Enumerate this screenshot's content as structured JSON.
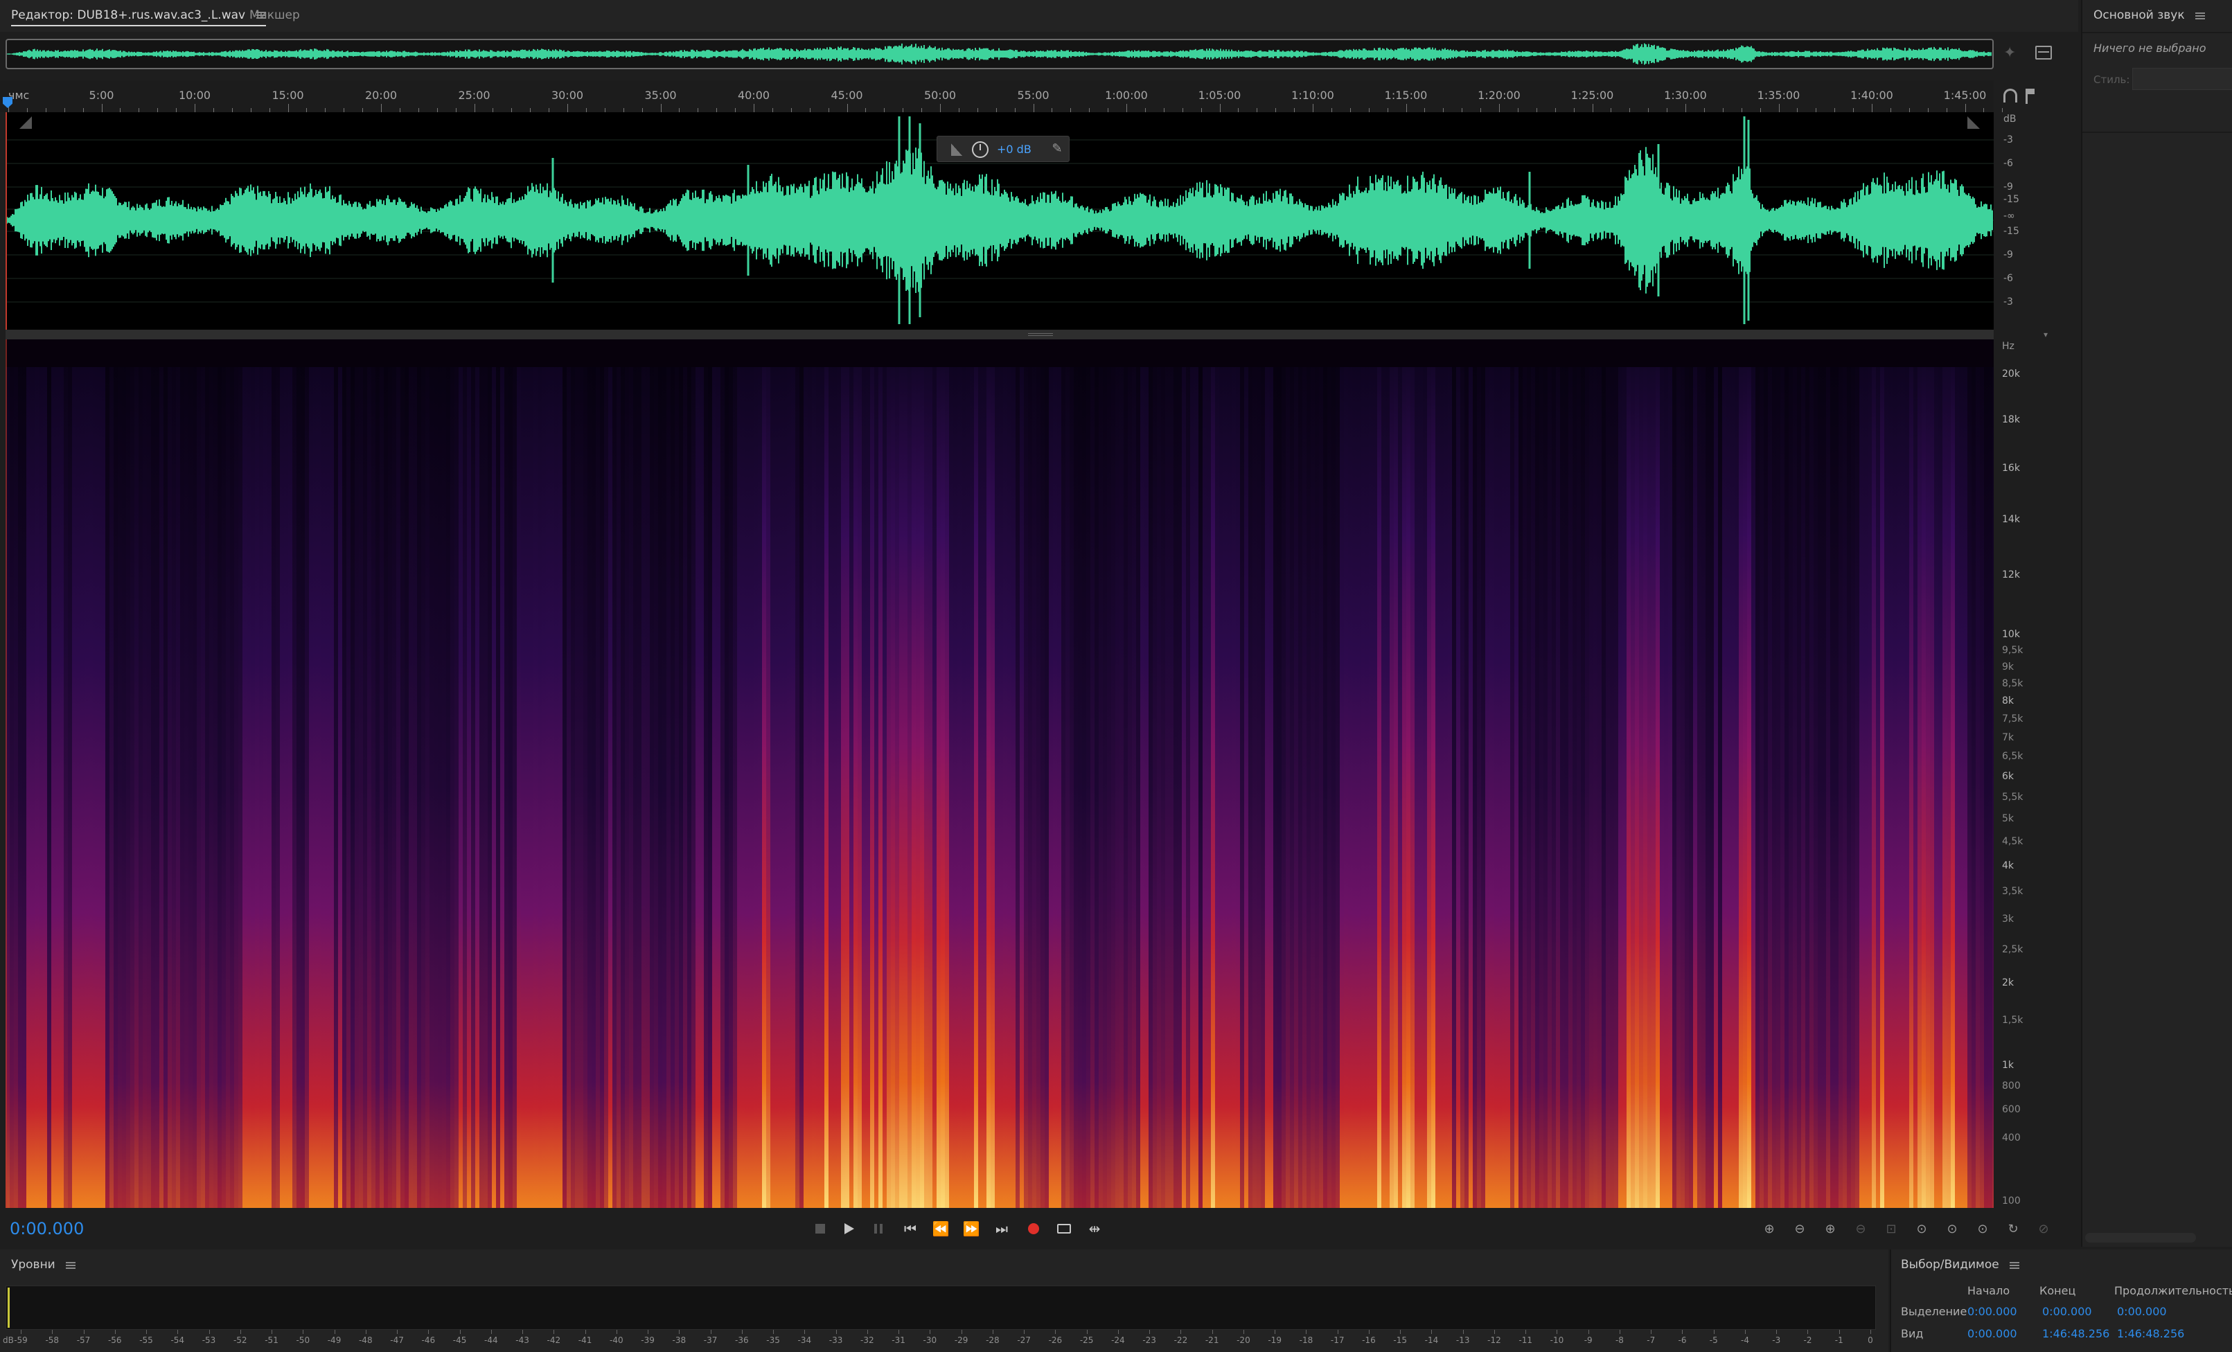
{
  "editor": {
    "tab_label": "Редактор: DUB18+.rus.wav.ac3_.L.wav",
    "mixer_tab": "Микшер"
  },
  "timeline": {
    "unit_label": "чмс",
    "ticks": [
      "5:00",
      "10:00",
      "15:00",
      "20:00",
      "25:00",
      "30:00",
      "35:00",
      "40:00",
      "45:00",
      "50:00",
      "55:00",
      "1:00:00",
      "1:05:00",
      "1:10:00",
      "1:15:00",
      "1:20:00",
      "1:25:00",
      "1:30:00",
      "1:35:00",
      "1:40:00",
      "1:45:00"
    ]
  },
  "waveform": {
    "color": "#3ed39c",
    "hud_gain": "+0 dB",
    "db_unit": "dB",
    "db_labels": [
      "-3",
      "-6",
      "-9",
      "-15",
      "-∞",
      "-15",
      "-9",
      "-6",
      "-3"
    ]
  },
  "spectrogram": {
    "hz_unit": "Hz",
    "hz_labels": [
      "20k",
      "18k",
      "16k",
      "14k",
      "12k",
      "10k",
      "9,5k",
      "9k",
      "8,5k",
      "8k",
      "7,5k",
      "7k",
      "6,5k",
      "6k",
      "5,5k",
      "5k",
      "4,5k",
      "4k",
      "3,5k",
      "3k",
      "2,5k",
      "2k",
      "1,5k",
      "1k",
      "800",
      "600",
      "400",
      "100"
    ]
  },
  "transport": {
    "current_time": "0:00.000",
    "icons": [
      "stop-icon",
      "play-icon",
      "pause-icon",
      "skip-start-icon",
      "rewind-icon",
      "fast-forward-icon",
      "skip-end-icon",
      "record-icon",
      "loop-icon",
      "skip-selection-icon"
    ]
  },
  "zoom": {
    "icons": [
      "zoom-in-amplitude-icon",
      "zoom-out-amplitude-icon",
      "zoom-in-time-icon",
      "zoom-out-time-icon",
      "zoom-full-icon",
      "zoom-selection-icon",
      "zoom-in-left-icon",
      "zoom-in-right-icon",
      "zoom-out-full-icon",
      "zoom-reset-icon"
    ]
  },
  "essential_sound": {
    "title": "Основной звук",
    "nothing_selected": "Ничего не выбрано",
    "style_label": "Стиль:"
  },
  "levels": {
    "title": "Уровни",
    "scale_unit": "dB",
    "scale": [
      "-59",
      "-58",
      "-57",
      "-56",
      "-55",
      "-54",
      "-53",
      "-52",
      "-51",
      "-50",
      "-49",
      "-48",
      "-47",
      "-46",
      "-45",
      "-44",
      "-43",
      "-42",
      "-41",
      "-40",
      "-39",
      "-38",
      "-37",
      "-36",
      "-35",
      "-34",
      "-33",
      "-32",
      "-31",
      "-30",
      "-29",
      "-28",
      "-27",
      "-26",
      "-25",
      "-24",
      "-23",
      "-22",
      "-21",
      "-20",
      "-19",
      "-18",
      "-17",
      "-16",
      "-15",
      "-14",
      "-13",
      "-12",
      "-11",
      "-10",
      "-9",
      "-8",
      "-7",
      "-6",
      "-5",
      "-4",
      "-3",
      "-2",
      "-1",
      "0"
    ]
  },
  "selection_view": {
    "title": "Выбор/Видимое",
    "col_start": "Начало",
    "col_end": "Конец",
    "col_duration": "Продолжительность",
    "rows": [
      {
        "label": "Выделение",
        "start": "0:00.000",
        "end": "0:00.000",
        "duration": "0:00.000"
      },
      {
        "label": "Вид",
        "start": "0:00.000",
        "end": "1:46:48.256",
        "duration": "1:46:48.256"
      }
    ]
  },
  "colors": {
    "accent_blue": "#2d8ceb",
    "record_red": "#e0302a",
    "waveform_green": "#3ed39c"
  }
}
